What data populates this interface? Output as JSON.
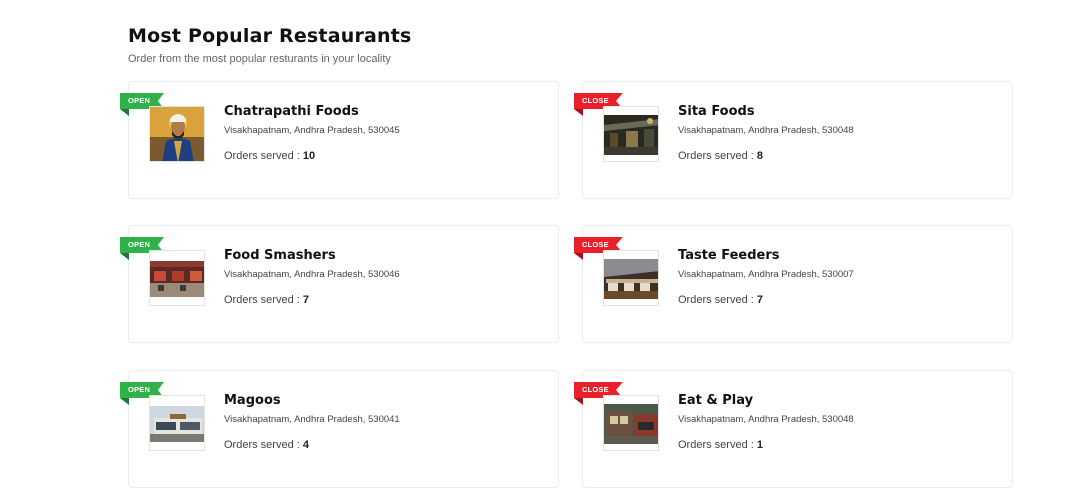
{
  "section": {
    "title": "Most Popular Restaurants",
    "subtitle": "Order from the most popular resturants in your locality"
  },
  "orders_label": "Orders served : ",
  "status_colors": {
    "open": "#2fb24a",
    "close": "#e8202a"
  },
  "restaurants": [
    {
      "name": "Chatrapathi Foods",
      "address": "Visakhapatnam, Andhra Pradesh, 530045",
      "orders": "10",
      "status": "OPEN",
      "image": "warrior-portrait-image"
    },
    {
      "name": "Sita Foods",
      "address": "Visakhapatnam, Andhra Pradesh, 530048",
      "orders": "8",
      "status": "CLOSE",
      "image": "night-terrace-image"
    },
    {
      "name": "Food Smashers",
      "address": "Visakhapatnam, Andhra Pradesh, 530046",
      "orders": "7",
      "status": "OPEN",
      "image": "food-court-image"
    },
    {
      "name": "Taste Feeders",
      "address": "Visakhapatnam, Andhra Pradesh, 530007",
      "orders": "7",
      "status": "CLOSE",
      "image": "dining-hall-image"
    },
    {
      "name": "Magoos",
      "address": "Visakhapatnam, Andhra Pradesh, 530041",
      "orders": "4",
      "status": "OPEN",
      "image": "building-exterior-image"
    },
    {
      "name": "Eat & Play",
      "address": "Visakhapatnam, Andhra Pradesh, 530048",
      "orders": "1",
      "status": "CLOSE",
      "image": "storefront-image"
    }
  ]
}
